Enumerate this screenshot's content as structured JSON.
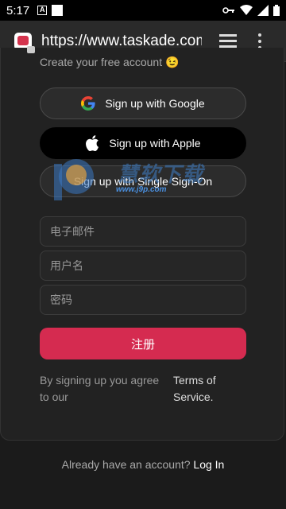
{
  "status_bar": {
    "time": "5:17",
    "notification_icon_letter": "A",
    "icons": [
      "key-icon",
      "wifi-icon",
      "cellular-icon",
      "battery-icon"
    ]
  },
  "browser": {
    "url": "https://www.taskade.com",
    "icons": [
      "favicon",
      "tabs-icon",
      "overflow-menu-icon"
    ]
  },
  "page": {
    "subtitle": "Create your free account 😉",
    "google_button": "Sign up with Google",
    "apple_button": "Sign up with Apple",
    "sso_button": "Sign up with Single Sign-On",
    "email_placeholder": "电子邮件",
    "username_placeholder": "用户名",
    "password_placeholder": "密码",
    "signup_button": "注册",
    "agree_text": "By signing up you agree to our",
    "terms_link": "Terms of Service.",
    "login_prompt": "Already have an account?",
    "login_link": "Log In"
  },
  "watermark": {
    "text": "慧软下载",
    "domain": "www.j9p.com"
  },
  "colors": {
    "accent": "#d52b50",
    "background": "#1b1b1b",
    "card": "#222222"
  }
}
